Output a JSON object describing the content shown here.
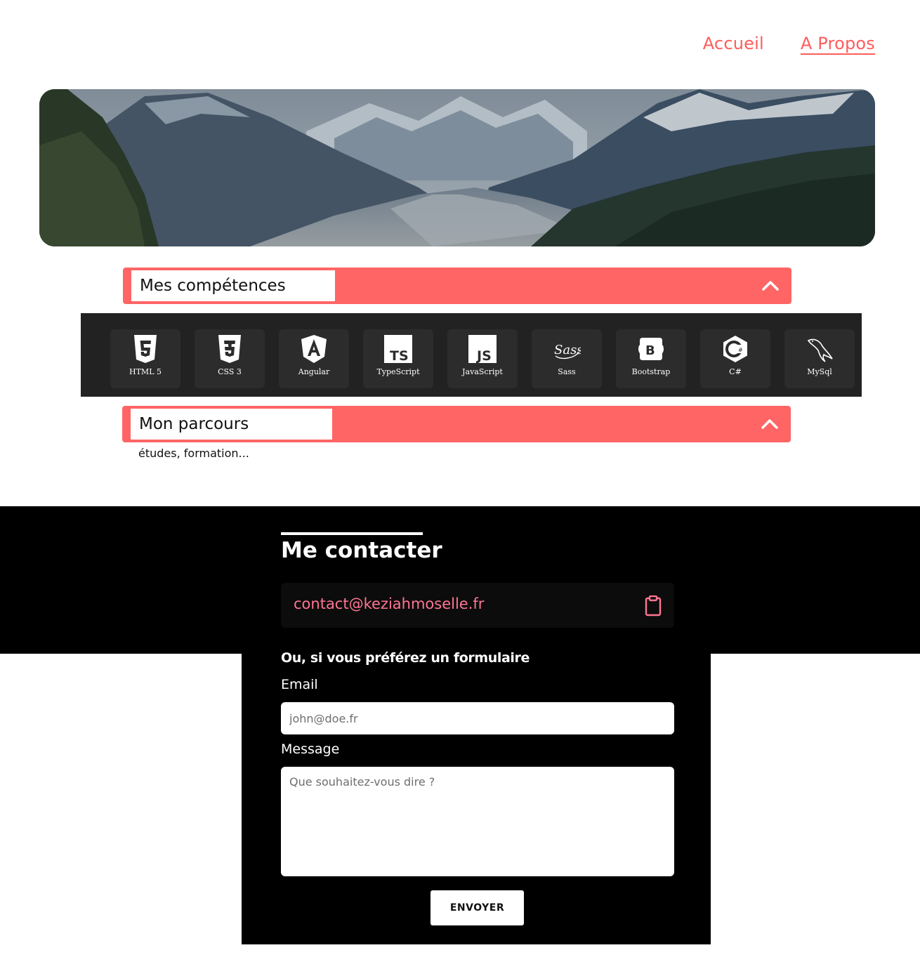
{
  "nav": {
    "items": [
      {
        "label": "Accueil",
        "active": false
      },
      {
        "label": "A Propos",
        "active": true
      }
    ],
    "accent": "#ff5c5c"
  },
  "hero": {
    "image": "mountain-valley-landscape"
  },
  "sections": {
    "skills": {
      "title": "Mes compétences",
      "icon": "chevron-up-icon",
      "bg": "#ff6565"
    },
    "parcours": {
      "title": "Mon parcours",
      "icon": "chevron-up-icon",
      "text": "études, formation..."
    }
  },
  "skills": [
    {
      "name": "HTML  5",
      "icon": "html5-icon"
    },
    {
      "name": "CSS  3",
      "icon": "css3-icon"
    },
    {
      "name": "Angular",
      "icon": "angular-icon"
    },
    {
      "name": "TypeScript",
      "icon": "typescript-icon"
    },
    {
      "name": "JavaScript",
      "icon": "javascript-icon"
    },
    {
      "name": "Sass",
      "icon": "sass-icon"
    },
    {
      "name": "Bootstrap",
      "icon": "bootstrap-icon"
    },
    {
      "name": "C#",
      "icon": "csharp-icon"
    },
    {
      "name": "MySql",
      "icon": "mysql-icon"
    }
  ],
  "contact": {
    "title": "Me contacter",
    "email": "contact@keziahmoselle.fr",
    "email_color": "#ff7591",
    "copy_icon": "clipboard-icon",
    "form_intro": "Ou, si vous préférez un formulaire",
    "email_label": "Email",
    "email_placeholder": "john@doe.fr",
    "message_label": "Message",
    "message_placeholder": "Que souhaitez-vous dire ?",
    "submit_label": "ENVOYER"
  }
}
